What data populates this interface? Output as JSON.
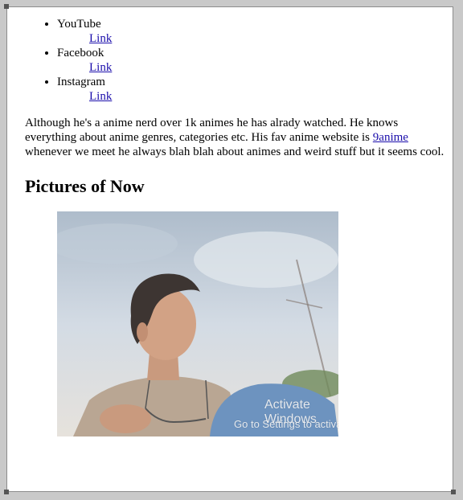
{
  "social": [
    {
      "name": "YouTube",
      "link_label": "Link"
    },
    {
      "name": "Facebook",
      "link_label": "Link"
    },
    {
      "name": "Instagram",
      "link_label": "Link"
    }
  ],
  "bio": {
    "text_before": "Although he's a anime nerd over 1k animes he has alrady watched. He knows everything about anime genres, categories etc. His fav anime website is ",
    "link_label": "9anime",
    "text_after": " whenever we meet he always blah blah about animes and weird stuff but it seems cool."
  },
  "section_title": "Pictures of Now",
  "watermark": {
    "line1": "Activate Windows",
    "line2": "Go to Settings to activate Windows."
  },
  "colors": {
    "link": "#1a0dab",
    "page_bg": "#ffffff",
    "window_bg": "#c9c9c9"
  }
}
